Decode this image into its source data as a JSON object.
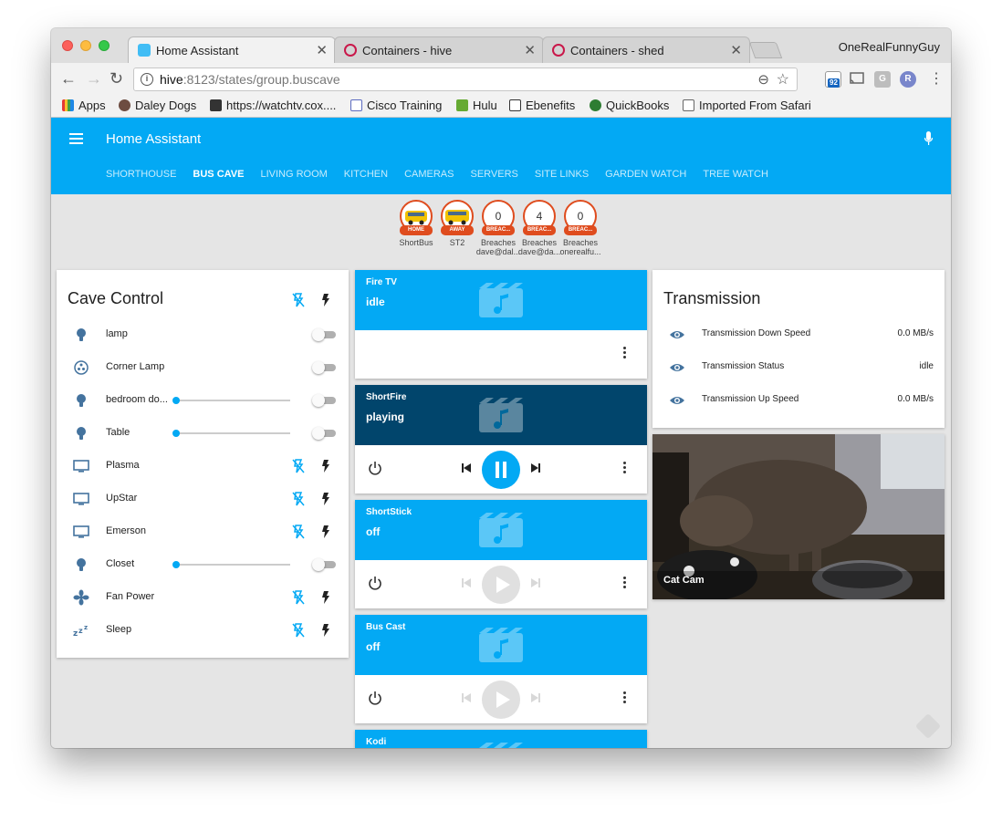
{
  "browser": {
    "tabs": [
      {
        "title": "Home Assistant",
        "active": true
      },
      {
        "title": "Containers - hive",
        "active": false
      },
      {
        "title": "Containers - shed",
        "active": false
      }
    ],
    "profile_name": "OneRealFunnyGuy",
    "url_host": "hive",
    "url_rest": ":8123/states/group.buscave",
    "extension_badge": "92",
    "ext_g": "G",
    "ext_r": "R",
    "bookmarks": [
      "Apps",
      "Daley Dogs",
      "https://watchtv.cox....",
      "Cisco Training",
      "Hulu",
      "Ebenefits",
      "QuickBooks",
      "Imported From Safari"
    ]
  },
  "app": {
    "title": "Home Assistant",
    "tabs": [
      "SHORTHOUSE",
      "BUS CAVE",
      "LIVING ROOM",
      "KITCHEN",
      "CAMERAS",
      "SERVERS",
      "SITE LINKS",
      "GARDEN WATCH",
      "TREE WATCH"
    ],
    "active_tab": "BUS CAVE"
  },
  "badges": [
    {
      "value": "",
      "tag": "HOME",
      "name": "ShortBus",
      "kind": "image"
    },
    {
      "value": "",
      "tag": "AWAY",
      "name": "ST2",
      "kind": "image"
    },
    {
      "value": "0",
      "tag": "BREAC...",
      "name": "Breaches",
      "sub": "dave@dal...",
      "kind": "number"
    },
    {
      "value": "4",
      "tag": "BREAC...",
      "name": "Breaches",
      "sub": "dave@da...",
      "kind": "number"
    },
    {
      "value": "0",
      "tag": "BREAC...",
      "name": "Breaches",
      "sub": "onerealfu...",
      "kind": "number"
    }
  ],
  "cave_control": {
    "title": "Cave Control",
    "rows": [
      {
        "label": "lamp",
        "icon": "bulb-icon",
        "control": "toggle",
        "on": false
      },
      {
        "label": "Corner Lamp",
        "icon": "dots-circle-icon",
        "control": "toggle",
        "on": false
      },
      {
        "label": "bedroom do...",
        "icon": "bulb-icon",
        "control": "slider-toggle",
        "on": false,
        "level": 0
      },
      {
        "label": "Table",
        "icon": "bulb-icon",
        "control": "slider-toggle",
        "on": false,
        "level": 0
      },
      {
        "label": "Plasma",
        "icon": "monitor-icon",
        "control": "flash"
      },
      {
        "label": "UpStar",
        "icon": "monitor-icon",
        "control": "flash"
      },
      {
        "label": "Emerson",
        "icon": "monitor-icon",
        "control": "flash"
      },
      {
        "label": "Closet",
        "icon": "bulb-icon",
        "control": "slider-toggle",
        "on": false,
        "level": 0
      },
      {
        "label": "Fan Power",
        "icon": "fan-icon",
        "control": "flash"
      },
      {
        "label": "Sleep",
        "icon": "sleep-icon",
        "control": "flash"
      }
    ]
  },
  "media_players": [
    {
      "name": "Fire TV",
      "state": "idle",
      "style": "light",
      "controls": "menu-only"
    },
    {
      "name": "ShortFire",
      "state": "playing",
      "style": "dark",
      "controls": "active"
    },
    {
      "name": "ShortStick",
      "state": "off",
      "style": "light",
      "controls": "disabled"
    },
    {
      "name": "Bus Cast",
      "state": "off",
      "style": "light",
      "controls": "disabled"
    },
    {
      "name": "Kodi",
      "state": "",
      "style": "light",
      "controls": "hidden"
    }
  ],
  "transmission": {
    "title": "Transmission",
    "rows": [
      {
        "label": "Transmission Down Speed",
        "value": "0.0 MB/s"
      },
      {
        "label": "Transmission Status",
        "value": "idle"
      },
      {
        "label": "Transmission Up Speed",
        "value": "0.0 MB/s"
      }
    ]
  },
  "camera": {
    "caption": "Cat Cam"
  },
  "colors": {
    "primary": "#03a9f4",
    "dark_media": "#01456c",
    "badge_red": "#df4c1e",
    "icon_blue": "#44739e"
  }
}
